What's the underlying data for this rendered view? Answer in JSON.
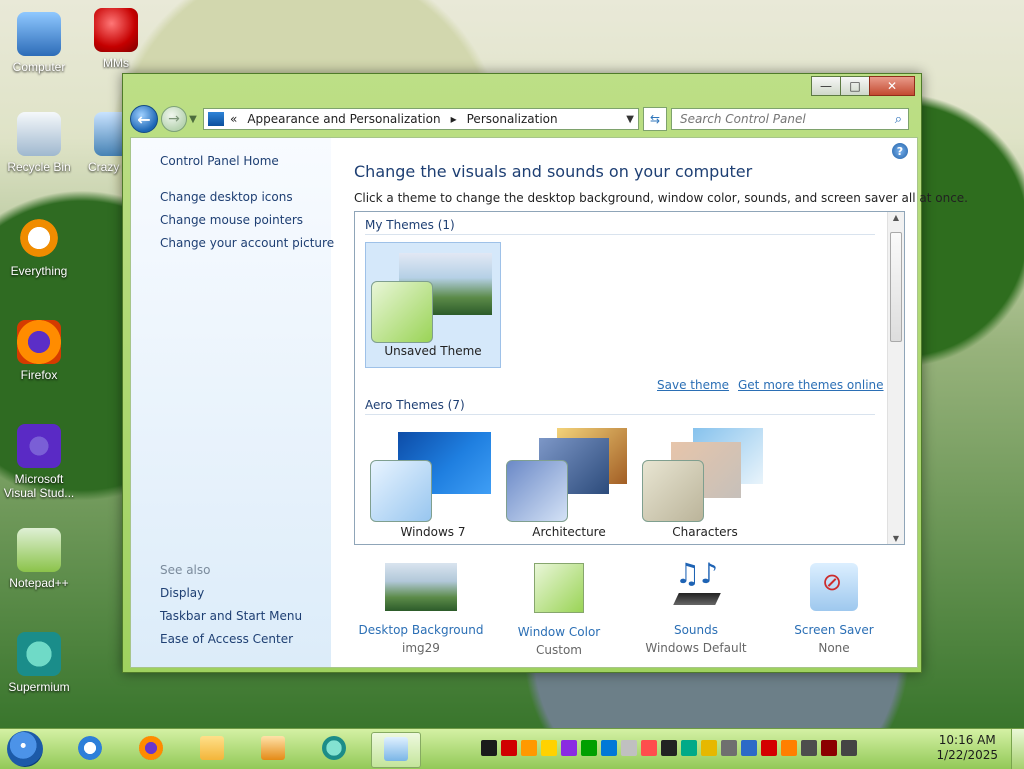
{
  "desktop": {
    "icons": [
      {
        "label": "Computer"
      },
      {
        "label": "MMs"
      },
      {
        "label": "Recycle Bin"
      },
      {
        "label": "Crazy Er..."
      },
      {
        "label": "Everything"
      },
      {
        "label": "Firefox"
      },
      {
        "label": "Microsoft Visual Stud..."
      },
      {
        "label": "Notepad++"
      },
      {
        "label": "Supermium"
      }
    ]
  },
  "window": {
    "title_buttons": {
      "minimize": "—",
      "maximize": "□",
      "close": "✕"
    },
    "nav": {
      "back": "←",
      "forward": "→",
      "address": {
        "prefix": "«",
        "segments": [
          "Appearance and Personalization",
          "Personalization"
        ]
      },
      "refresh": "⇆",
      "search_placeholder": "Search Control Panel",
      "search_icon": "⌕"
    },
    "left_panel": {
      "links": [
        "Control Panel Home",
        "Change desktop icons",
        "Change mouse pointers",
        "Change your account picture"
      ],
      "see_also_label": "See also",
      "see_also_links": [
        "Display",
        "Taskbar and Start Menu",
        "Ease of Access Center"
      ]
    },
    "main": {
      "help": "?",
      "title": "Change the visuals and sounds on your computer",
      "subtitle": "Click a theme to change the desktop background, window color, sounds, and screen saver all at once.",
      "my_themes_header": "My Themes (1)",
      "my_themes": [
        {
          "label": "Unsaved Theme"
        }
      ],
      "save_theme": "Save theme",
      "get_more_themes": "Get more themes online",
      "aero_themes_header": "Aero Themes (7)",
      "aero_themes": [
        {
          "label": "Windows 7"
        },
        {
          "label": "Architecture"
        },
        {
          "label": "Characters"
        }
      ],
      "bottom_items": [
        {
          "name": "Desktop Background",
          "value": "img29"
        },
        {
          "name": "Window Color",
          "value": "Custom"
        },
        {
          "name": "Sounds",
          "value": "Windows Default"
        },
        {
          "name": "Screen Saver",
          "value": "None"
        }
      ]
    }
  },
  "taskbar": {
    "clock_time": "10:16 AM",
    "clock_date": "1/22/2025",
    "tray_colors": [
      "#1a1a1a",
      "#d00000",
      "#ff9900",
      "#ffd200",
      "#8a2be2",
      "#00a000",
      "#0078d7",
      "#c0c0c0",
      "#ff4d4d",
      "#222",
      "#00aa88",
      "#e6b800",
      "#6f6f6f",
      "#2c6ac7",
      "#d40000",
      "#ff7f00",
      "#4d4d4d",
      "#8b0000",
      "#444"
    ]
  }
}
